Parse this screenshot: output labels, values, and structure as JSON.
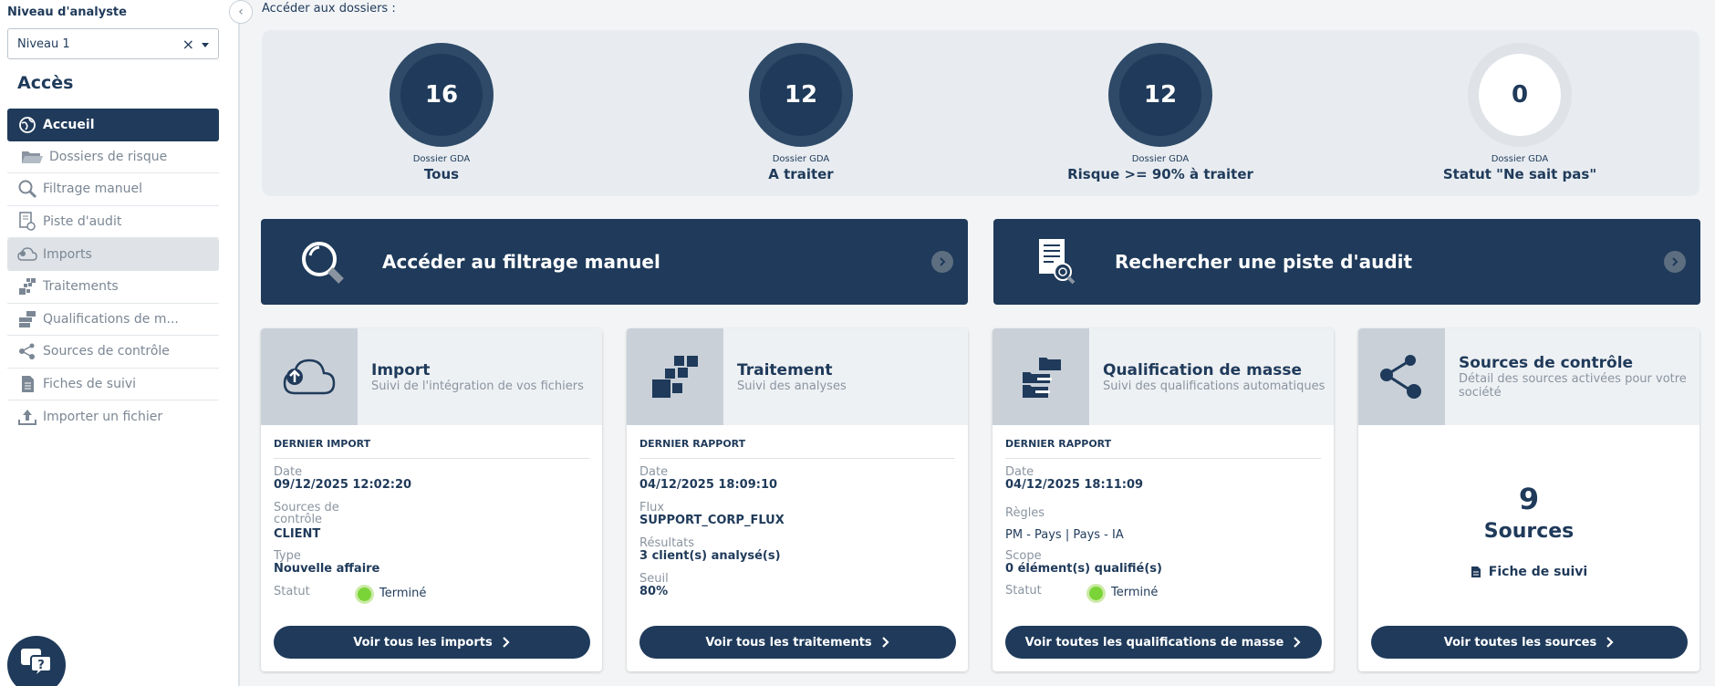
{
  "sidebar": {
    "level_label": "Niveau d'analyste",
    "level_value": "Niveau 1",
    "clear_symbol": "×",
    "section_title": "Accès",
    "items": [
      {
        "label": "Accueil"
      },
      {
        "label": "Dossiers de risque"
      },
      {
        "label": "Filtrage manuel"
      },
      {
        "label": "Piste d'audit"
      },
      {
        "label": "Imports"
      },
      {
        "label": "Traitements"
      },
      {
        "label": "Qualifications de m..."
      },
      {
        "label": "Sources de contrôle"
      },
      {
        "label": "Fiches de suivi"
      },
      {
        "label": "Importer un fichier"
      }
    ]
  },
  "main": {
    "access_label": "Accéder aux dossiers :",
    "stats": [
      {
        "value": "16",
        "sub": "Dossier GDA",
        "label": "Tous"
      },
      {
        "value": "12",
        "sub": "Dossier GDA",
        "label": "A traiter"
      },
      {
        "value": "12",
        "sub": "Dossier GDA",
        "label": "Risque >= 90% à traiter"
      },
      {
        "value": "0",
        "sub": "Dossier GDA",
        "label": "Statut \"Ne sait pas\""
      }
    ],
    "banners": [
      {
        "label": "Accéder au filtrage manuel"
      },
      {
        "label": "Rechercher une piste d'audit"
      }
    ],
    "cards": {
      "import": {
        "title": "Import",
        "subtitle": "Suivi de l'intégration de vos fichiers",
        "section": "DERNIER IMPORT",
        "date_label": "Date",
        "date_value": "09/12/2025 12:02:20",
        "sources_label": "Sources de contrôle",
        "sources_value": "CLIENT",
        "type_label": "Type",
        "type_value": "Nouvelle affaire",
        "status_label": "Statut",
        "status_value": "Terminé",
        "button": "Voir tous les imports"
      },
      "traitement": {
        "title": "Traitement",
        "subtitle": "Suivi des analyses",
        "section": "DERNIER RAPPORT",
        "date_label": "Date",
        "date_value": "04/12/2025 18:09:10",
        "flux_label": "Flux",
        "flux_value": "SUPPORT_CORP_FLUX",
        "result_label": "Résultats",
        "result_value": "3 client(s) analysé(s)",
        "seuil_label": "Seuil",
        "seuil_value": "80%",
        "button": "Voir tous les traitements"
      },
      "qualification": {
        "title": "Qualification de masse",
        "subtitle": "Suivi des qualifications automatiques",
        "section": "DERNIER RAPPORT",
        "date_label": "Date",
        "date_value": "04/12/2025 18:11:09",
        "rules_label": "Règles",
        "rules_value": "PM - Pays | Pays - IA",
        "scope_label": "Scope",
        "scope_value": "0 élément(s) qualifié(s)",
        "status_label": "Statut",
        "status_value": "Terminé",
        "button": "Voir toutes les qualifications de masse"
      },
      "sources": {
        "title": "Sources de contrôle",
        "subtitle": "Détail des sources activées pour votre société",
        "count": "9",
        "count_label": "Sources",
        "link": "Fiche de suivi",
        "button": "Voir toutes les sources"
      }
    }
  },
  "colors": {
    "primary": "#1f3a5a",
    "status_ok": "#7ad437",
    "panel": "#e8ecf0"
  }
}
